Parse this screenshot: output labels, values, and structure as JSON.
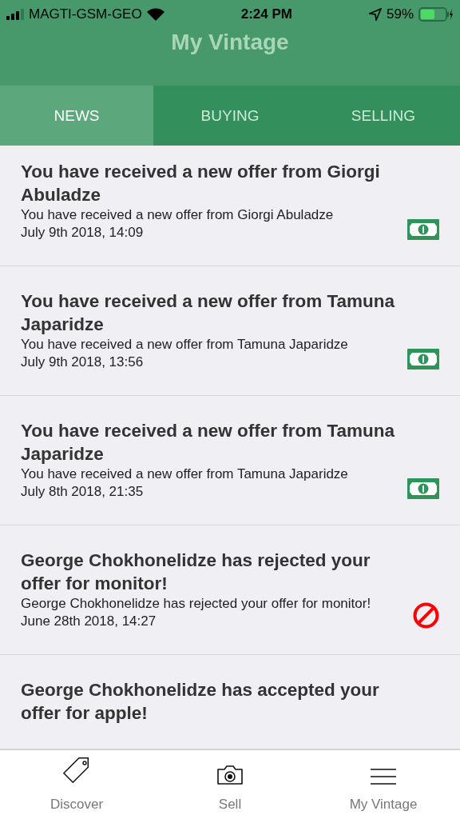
{
  "status_bar": {
    "carrier": "MAGTI-GSM-GEO",
    "time": "2:24 PM",
    "battery": "59%"
  },
  "header": {
    "title": "My Vintage"
  },
  "tabs": [
    {
      "label": "NEWS",
      "selected": true
    },
    {
      "label": "BUYING",
      "selected": false
    },
    {
      "label": "SELLING",
      "selected": false
    }
  ],
  "news": [
    {
      "title": "You have received a new offer from Giorgi Abuladze",
      "message": "You have received a new offer from Giorgi Abuladze",
      "date": "July 9th 2018, 14:09",
      "kind": "offer"
    },
    {
      "title": "You have received a new offer from Tamuna Japaridze",
      "message": "You have received a new offer from Tamuna Japaridze",
      "date": "July 9th 2018, 13:56",
      "kind": "offer"
    },
    {
      "title": "You have received a new offer from Tamuna Japaridze",
      "message": "You have received a new offer from Tamuna Japaridze",
      "date": "July 8th 2018, 21:35",
      "kind": "offer"
    },
    {
      "title": "George Chokhonelidze has rejected your offer for monitor!",
      "message": "George Chokhonelidze has rejected your offer for monitor!",
      "date": "June 28th 2018, 14:27",
      "kind": "rejected"
    },
    {
      "title": "George Chokhonelidze has accepted your offer for apple!"
    }
  ],
  "tab_bar": [
    {
      "label": "Discover",
      "kind": "tag"
    },
    {
      "label": "Sell",
      "kind": "camera"
    },
    {
      "label": "My Vintage",
      "kind": "menu"
    }
  ]
}
